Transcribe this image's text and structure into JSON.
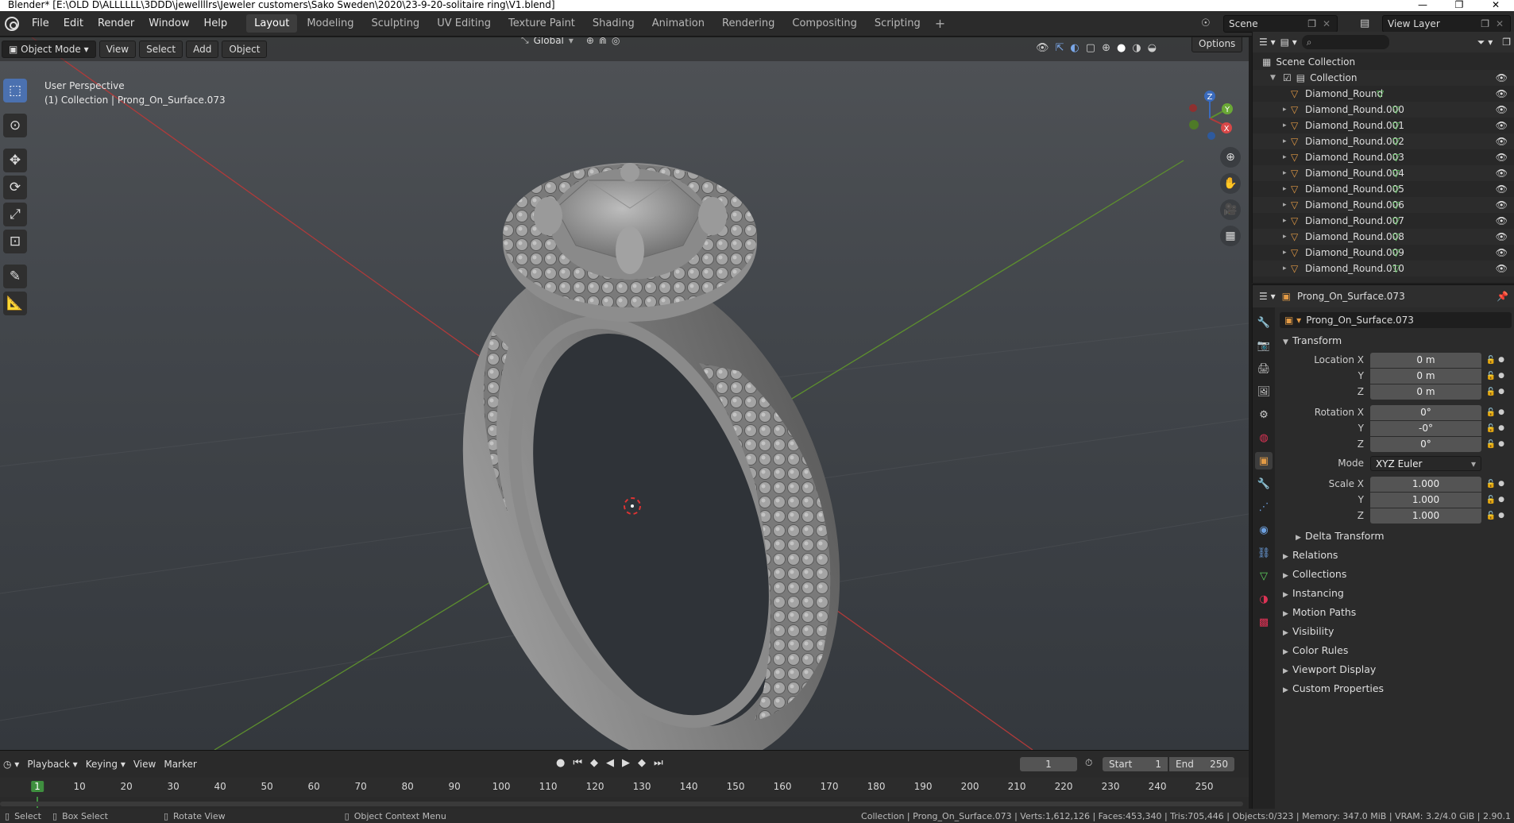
{
  "window": {
    "title": "Blender* [E:\\OLD D\\ALLLLLL\\3DDD\\jewellllrs\\Jeweler customers\\Sako Sweden\\2020\\23-9-20-solitaire ring\\V1.blend]",
    "minimize": "—",
    "maximize": "❐",
    "close": "✕"
  },
  "menu": [
    "File",
    "Edit",
    "Render",
    "Window",
    "Help"
  ],
  "workspaces": [
    "Layout",
    "Modeling",
    "Sculpting",
    "UV Editing",
    "Texture Paint",
    "Shading",
    "Animation",
    "Rendering",
    "Compositing",
    "Scripting"
  ],
  "active_workspace": "Layout",
  "scene": {
    "name": "Scene",
    "view_layer": "View Layer"
  },
  "viewport": {
    "mode": "Object Mode",
    "menus": [
      "View",
      "Select",
      "Add",
      "Object"
    ],
    "orientation": "Global",
    "options_label": "Options",
    "perspective_label": "User Perspective",
    "collection_label": "(1) Collection | Prong_On_Surface.073",
    "gizmo_axes": {
      "x": "X",
      "y": "Y",
      "z": "Z"
    }
  },
  "timeline": {
    "menus": [
      "Playback",
      "Keying",
      "View",
      "Marker"
    ],
    "current_frame": "1",
    "start_label": "Start",
    "start": "1",
    "end_label": "End",
    "end": "250",
    "ticks": [
      "1",
      "10",
      "20",
      "30",
      "40",
      "50",
      "60",
      "70",
      "80",
      "90",
      "100",
      "110",
      "120",
      "130",
      "140",
      "150",
      "160",
      "170",
      "180",
      "190",
      "200",
      "210",
      "220",
      "230",
      "240",
      "250"
    ]
  },
  "statusbar": {
    "select": "Select",
    "box_select": "Box Select",
    "rotate_view": "Rotate View",
    "context_menu": "Object Context Menu",
    "stats": "Collection | Prong_On_Surface.073 | Verts:1,612,126 | Faces:453,340 | Tris:705,446 | Objects:0/323 | Memory: 347.0 MiB | VRAM: 3.2/4.0 GiB | 2.90.1"
  },
  "outliner": {
    "scene_collection": "Scene Collection",
    "collection": "Collection",
    "items": [
      "Diamond_Round",
      "Diamond_Round.000",
      "Diamond_Round.001",
      "Diamond_Round.002",
      "Diamond_Round.003",
      "Diamond_Round.004",
      "Diamond_Round.005",
      "Diamond_Round.006",
      "Diamond_Round.007",
      "Diamond_Round.008",
      "Diamond_Round.009",
      "Diamond_Round.010"
    ]
  },
  "properties": {
    "object_name": "Prong_On_Surface.073",
    "transform_title": "Transform",
    "location_label": "Location X",
    "rotation_label": "Rotation X",
    "scale_label": "Scale X",
    "y_label": "Y",
    "z_label": "Z",
    "location": [
      "0 m",
      "0 m",
      "0 m"
    ],
    "rotation": [
      "0°",
      "-0°",
      "0°"
    ],
    "mode_label": "Mode",
    "mode": "XYZ Euler",
    "scale": [
      "1.000",
      "1.000",
      "1.000"
    ],
    "delta_transform": "Delta Transform",
    "panels": [
      "Relations",
      "Collections",
      "Instancing",
      "Motion Paths",
      "Visibility",
      "Color Rules",
      "Viewport Display",
      "Custom Properties"
    ]
  },
  "colors": {
    "accent": "#4b71b0",
    "x_axis": "#b03a3a",
    "y_axis": "#5d8f2e",
    "object_orange": "#e29a45",
    "mesh_green": "#5fd35f",
    "frame_green": "#3f8f3f"
  }
}
